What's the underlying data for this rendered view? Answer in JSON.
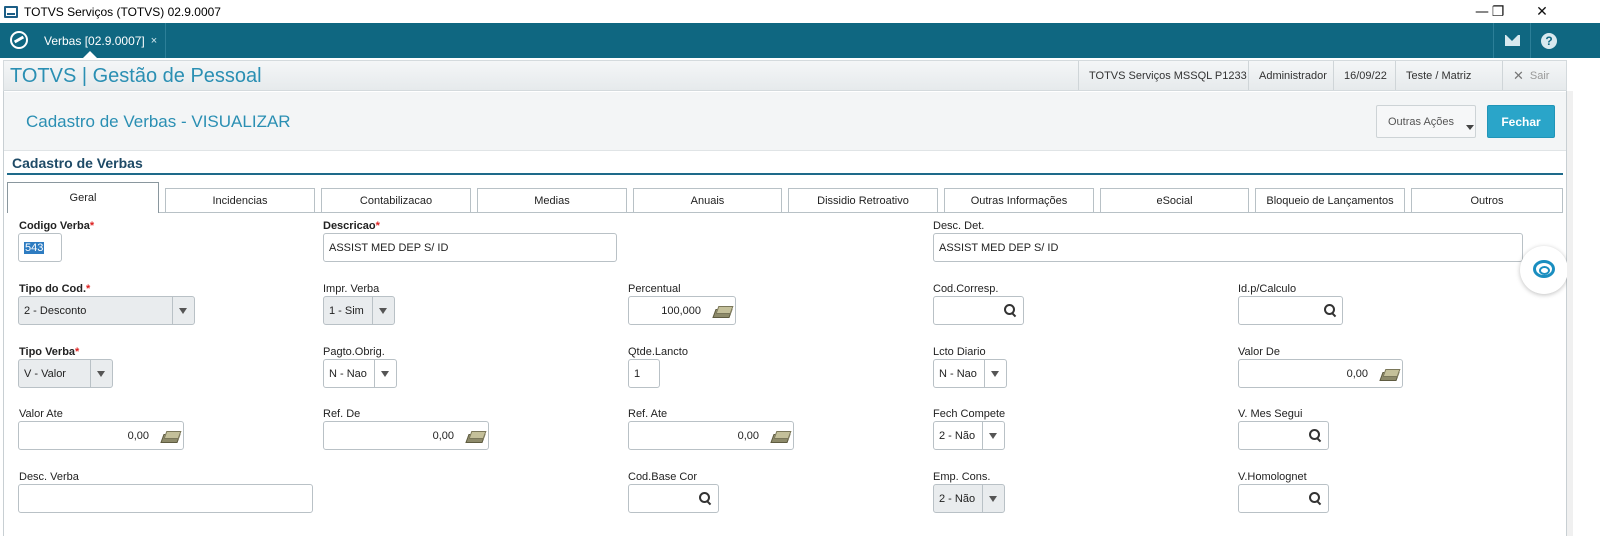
{
  "window": {
    "title": "TOTVS Serviços (TOTVS) 02.9.0007",
    "minimize": "—",
    "restore": "❐",
    "close": "✕"
  },
  "topbar": {
    "tab_label": "Verbas [02.9.0007]",
    "tab_close": "×",
    "mail_icon": "mail-icon",
    "help_glyph": "?"
  },
  "module": {
    "title": "TOTVS | Gestão de Pessoal",
    "environment": "TOTVS Serviços MSSQL P1233",
    "user": "Administrador",
    "date": "16/09/22",
    "branch": "Teste / Matriz",
    "exit_label": "Sair"
  },
  "page": {
    "title": "Cadastro de Verbas - VISUALIZAR",
    "other_actions": "Outras Ações",
    "close": "Fechar",
    "section_title": "Cadastro de Verbas"
  },
  "tabs": [
    "Geral",
    "Incidencias",
    "Contabilizacao",
    "Medias",
    "Anuais",
    "Dissidio Retroativo",
    "Outras Informações",
    "eSocial",
    "Bloqueio de Lançamentos",
    "Outros"
  ],
  "form": {
    "codigo_verba": {
      "label": "Codigo Verba",
      "value": "543"
    },
    "descricao": {
      "label": "Descricao",
      "value": "ASSIST MED DEP S/ ID"
    },
    "desc_det": {
      "label": "Desc. Det.",
      "value": "ASSIST MED DEP S/ ID"
    },
    "tipo_cod": {
      "label": "Tipo do Cod.",
      "value": "2 - Desconto"
    },
    "impr_verba": {
      "label": "Impr. Verba",
      "value": "1 - Sim"
    },
    "percentual": {
      "label": "Percentual",
      "value": "100,000"
    },
    "cod_corresp": {
      "label": "Cod.Corresp.",
      "value": ""
    },
    "id_calculo": {
      "label": "Id.p/Calculo",
      "value": ""
    },
    "tipo_verba": {
      "label": "Tipo Verba",
      "value": "V - Valor"
    },
    "pagto_obrig": {
      "label": "Pagto.Obrig.",
      "value": "N - Nao"
    },
    "qtde_lancto": {
      "label": "Qtde.Lancto",
      "value": "1"
    },
    "lcto_diario": {
      "label": "Lcto Diario",
      "value": "N - Nao"
    },
    "valor_de": {
      "label": "Valor De",
      "value": "0,00"
    },
    "valor_ate": {
      "label": "Valor Ate",
      "value": "0,00"
    },
    "ref_de": {
      "label": "Ref. De",
      "value": "0,00"
    },
    "ref_ate": {
      "label": "Ref. Ate",
      "value": "0,00"
    },
    "fech_compete": {
      "label": "Fech Compete",
      "value": "2 - Não"
    },
    "v_mes_segui": {
      "label": "V. Mes Segui",
      "value": ""
    },
    "desc_verba": {
      "label": "Desc. Verba",
      "value": ""
    },
    "cod_base_cor": {
      "label": "Cod.Base Cor",
      "value": ""
    },
    "emp_cons": {
      "label": "Emp. Cons.",
      "value": "2 - Não"
    },
    "v_homolognet": {
      "label": "V.Homolognet",
      "value": ""
    }
  },
  "required_mark": "*",
  "colors": {
    "brand_teal": "#0f6781",
    "title_blue": "#2a8fb3",
    "button_blue": "#2aa5c9",
    "required_red": "#dd2222"
  }
}
